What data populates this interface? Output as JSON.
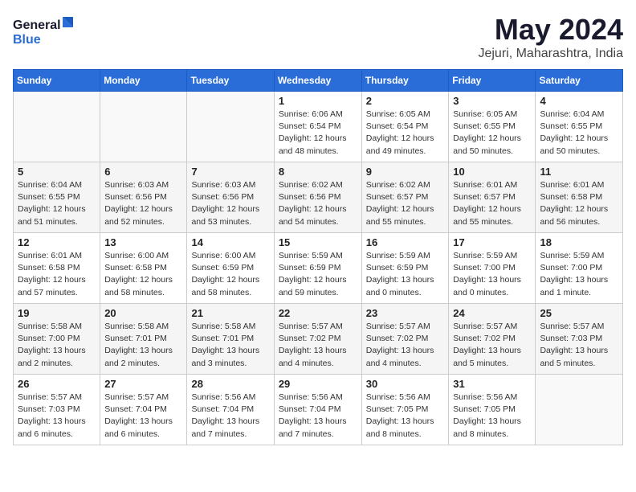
{
  "logo": {
    "line1": "General",
    "line2": "Blue"
  },
  "title": "May 2024",
  "location": "Jejuri, Maharashtra, India",
  "weekdays": [
    "Sunday",
    "Monday",
    "Tuesday",
    "Wednesday",
    "Thursday",
    "Friday",
    "Saturday"
  ],
  "weeks": [
    [
      {
        "day": "",
        "info": ""
      },
      {
        "day": "",
        "info": ""
      },
      {
        "day": "",
        "info": ""
      },
      {
        "day": "1",
        "info": "Sunrise: 6:06 AM\nSunset: 6:54 PM\nDaylight: 12 hours\nand 48 minutes."
      },
      {
        "day": "2",
        "info": "Sunrise: 6:05 AM\nSunset: 6:54 PM\nDaylight: 12 hours\nand 49 minutes."
      },
      {
        "day": "3",
        "info": "Sunrise: 6:05 AM\nSunset: 6:55 PM\nDaylight: 12 hours\nand 50 minutes."
      },
      {
        "day": "4",
        "info": "Sunrise: 6:04 AM\nSunset: 6:55 PM\nDaylight: 12 hours\nand 50 minutes."
      }
    ],
    [
      {
        "day": "5",
        "info": "Sunrise: 6:04 AM\nSunset: 6:55 PM\nDaylight: 12 hours\nand 51 minutes."
      },
      {
        "day": "6",
        "info": "Sunrise: 6:03 AM\nSunset: 6:56 PM\nDaylight: 12 hours\nand 52 minutes."
      },
      {
        "day": "7",
        "info": "Sunrise: 6:03 AM\nSunset: 6:56 PM\nDaylight: 12 hours\nand 53 minutes."
      },
      {
        "day": "8",
        "info": "Sunrise: 6:02 AM\nSunset: 6:56 PM\nDaylight: 12 hours\nand 54 minutes."
      },
      {
        "day": "9",
        "info": "Sunrise: 6:02 AM\nSunset: 6:57 PM\nDaylight: 12 hours\nand 55 minutes."
      },
      {
        "day": "10",
        "info": "Sunrise: 6:01 AM\nSunset: 6:57 PM\nDaylight: 12 hours\nand 55 minutes."
      },
      {
        "day": "11",
        "info": "Sunrise: 6:01 AM\nSunset: 6:58 PM\nDaylight: 12 hours\nand 56 minutes."
      }
    ],
    [
      {
        "day": "12",
        "info": "Sunrise: 6:01 AM\nSunset: 6:58 PM\nDaylight: 12 hours\nand 57 minutes."
      },
      {
        "day": "13",
        "info": "Sunrise: 6:00 AM\nSunset: 6:58 PM\nDaylight: 12 hours\nand 58 minutes."
      },
      {
        "day": "14",
        "info": "Sunrise: 6:00 AM\nSunset: 6:59 PM\nDaylight: 12 hours\nand 58 minutes."
      },
      {
        "day": "15",
        "info": "Sunrise: 5:59 AM\nSunset: 6:59 PM\nDaylight: 12 hours\nand 59 minutes."
      },
      {
        "day": "16",
        "info": "Sunrise: 5:59 AM\nSunset: 6:59 PM\nDaylight: 13 hours\nand 0 minutes."
      },
      {
        "day": "17",
        "info": "Sunrise: 5:59 AM\nSunset: 7:00 PM\nDaylight: 13 hours\nand 0 minutes."
      },
      {
        "day": "18",
        "info": "Sunrise: 5:59 AM\nSunset: 7:00 PM\nDaylight: 13 hours\nand 1 minute."
      }
    ],
    [
      {
        "day": "19",
        "info": "Sunrise: 5:58 AM\nSunset: 7:00 PM\nDaylight: 13 hours\nand 2 minutes."
      },
      {
        "day": "20",
        "info": "Sunrise: 5:58 AM\nSunset: 7:01 PM\nDaylight: 13 hours\nand 2 minutes."
      },
      {
        "day": "21",
        "info": "Sunrise: 5:58 AM\nSunset: 7:01 PM\nDaylight: 13 hours\nand 3 minutes."
      },
      {
        "day": "22",
        "info": "Sunrise: 5:57 AM\nSunset: 7:02 PM\nDaylight: 13 hours\nand 4 minutes."
      },
      {
        "day": "23",
        "info": "Sunrise: 5:57 AM\nSunset: 7:02 PM\nDaylight: 13 hours\nand 4 minutes."
      },
      {
        "day": "24",
        "info": "Sunrise: 5:57 AM\nSunset: 7:02 PM\nDaylight: 13 hours\nand 5 minutes."
      },
      {
        "day": "25",
        "info": "Sunrise: 5:57 AM\nSunset: 7:03 PM\nDaylight: 13 hours\nand 5 minutes."
      }
    ],
    [
      {
        "day": "26",
        "info": "Sunrise: 5:57 AM\nSunset: 7:03 PM\nDaylight: 13 hours\nand 6 minutes."
      },
      {
        "day": "27",
        "info": "Sunrise: 5:57 AM\nSunset: 7:04 PM\nDaylight: 13 hours\nand 6 minutes."
      },
      {
        "day": "28",
        "info": "Sunrise: 5:56 AM\nSunset: 7:04 PM\nDaylight: 13 hours\nand 7 minutes."
      },
      {
        "day": "29",
        "info": "Sunrise: 5:56 AM\nSunset: 7:04 PM\nDaylight: 13 hours\nand 7 minutes."
      },
      {
        "day": "30",
        "info": "Sunrise: 5:56 AM\nSunset: 7:05 PM\nDaylight: 13 hours\nand 8 minutes."
      },
      {
        "day": "31",
        "info": "Sunrise: 5:56 AM\nSunset: 7:05 PM\nDaylight: 13 hours\nand 8 minutes."
      },
      {
        "day": "",
        "info": ""
      }
    ]
  ]
}
